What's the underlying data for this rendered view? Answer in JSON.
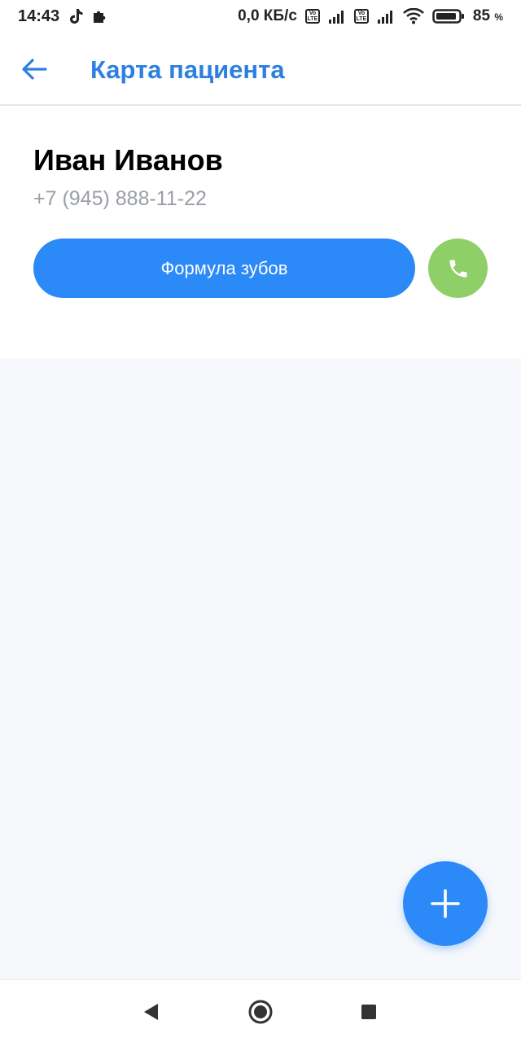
{
  "status_bar": {
    "time": "14:43",
    "network_speed": "0,0 КБ/с",
    "volte_label_top": "Vo",
    "volte_label_bottom": "LTE",
    "battery_percent": "85",
    "battery_unit": "%",
    "icons": [
      "tiktok-icon",
      "puzzle-icon",
      "volte-icon",
      "signal-icon",
      "wifi-icon",
      "battery-icon"
    ]
  },
  "app_bar": {
    "title": "Карта пациента",
    "back_icon": "arrow-left-icon"
  },
  "patient": {
    "name": "Иван Иванов",
    "phone": "+7 (945) 888-11-22"
  },
  "actions": {
    "formula_label": "Формула зубов",
    "call_icon": "phone-icon",
    "fab_icon": "plus-icon"
  },
  "colors": {
    "accent": "#2b8af7",
    "title": "#2e7fe0",
    "call": "#8ed067",
    "content_bg": "#f6f8fc",
    "muted_text": "#9a9ea6"
  },
  "nav_bar": {
    "icons": [
      "back-triangle-icon",
      "home-circle-icon",
      "recents-square-icon"
    ]
  }
}
